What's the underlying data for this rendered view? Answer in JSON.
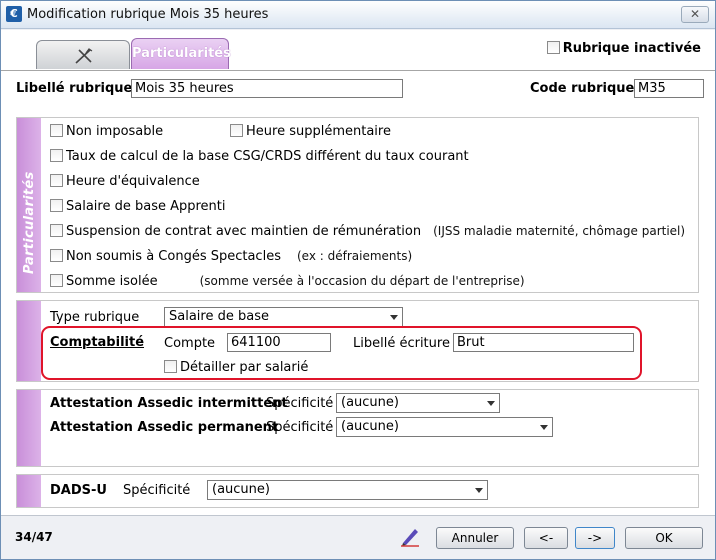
{
  "window": {
    "title": "Modification rubrique Mois 35 heures",
    "close_label": "✕"
  },
  "tabs": {
    "particularites_label": "Particularités"
  },
  "header": {
    "inactive_label": "Rubrique inactivée",
    "libelle_label": "Libellé rubrique",
    "libelle_value": "Mois 35 heures",
    "code_label": "Code rubrique",
    "code_value": "M35"
  },
  "particularites": {
    "side_label": "Particularités",
    "items": [
      {
        "label": "Non imposable",
        "note": ""
      },
      {
        "label": "Heure supplémentaire",
        "note": ""
      },
      {
        "label": "Taux de calcul de la base CSG/CRDS différent du taux courant",
        "note": ""
      },
      {
        "label": "Heure d'équivalence",
        "note": ""
      },
      {
        "label": "Salaire de base Apprenti",
        "note": ""
      },
      {
        "label": "Suspension de contrat avec maintien de rémunération",
        "note": "(IJSS maladie maternité, chômage partiel)"
      },
      {
        "label": "Non soumis à Congés Spectacles",
        "note": "(ex : défraiements)"
      },
      {
        "label": "Somme isolée",
        "note": "(somme versée à l'occasion du départ de l'entreprise)"
      }
    ]
  },
  "type_section": {
    "type_label": "Type rubrique",
    "type_value": "Salaire de base",
    "comptabilite_label": "Comptabilité",
    "compte_label": "Compte",
    "compte_value": "641100",
    "libelle_ecriture_label": "Libellé écriture",
    "libelle_ecriture_value": "Brut",
    "detailler_label": "Détailler par salarié"
  },
  "assedic": {
    "intermittent_label": "Attestation Assedic intermittent",
    "permanent_label": "Attestation Assedic permanent",
    "specificite_label": "Spécificité",
    "intermittent_value": "(aucune)",
    "permanent_value": "(aucune)"
  },
  "dads": {
    "label": "DADS-U",
    "specificite_label": "Spécificité",
    "value": "(aucune)"
  },
  "footer": {
    "counter": "34/47",
    "annuler": "Annuler",
    "prev": "<-",
    "next": "->",
    "ok": "OK"
  },
  "colors": {
    "accent": "#d7a6e6",
    "highlight_border": "#e0142a"
  }
}
